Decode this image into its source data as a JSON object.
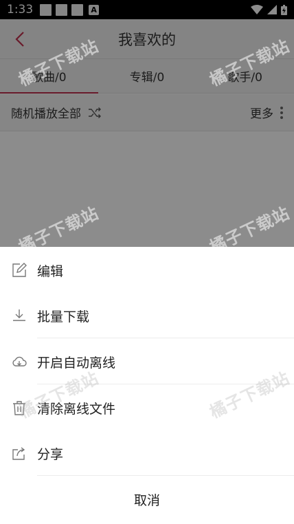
{
  "status_bar": {
    "time": "1:33",
    "a_badge": "A"
  },
  "header": {
    "title": "我喜欢的"
  },
  "tabs": [
    {
      "label": "歌曲/0"
    },
    {
      "label": "专辑/0"
    },
    {
      "label": "歌手/0"
    }
  ],
  "actions": {
    "play_all": "随机播放全部",
    "more": "更多"
  },
  "sheet": {
    "items": [
      {
        "label": "编辑",
        "icon": "edit-icon"
      },
      {
        "label": "批量下载",
        "icon": "download-icon"
      },
      {
        "label": "开启自动离线",
        "icon": "cloud-icon"
      },
      {
        "label": "清除离线文件",
        "icon": "trash-icon"
      },
      {
        "label": "分享",
        "icon": "share-icon"
      }
    ],
    "cancel": "取消"
  },
  "watermark": "橘子下载站",
  "colors": {
    "accent": "#c0304e",
    "status_bar": "#000000",
    "header_bg": "#f0f0f0"
  }
}
